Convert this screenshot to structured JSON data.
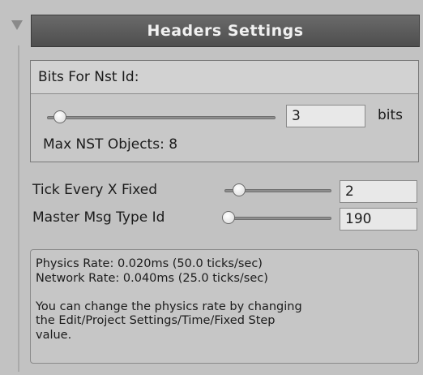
{
  "header": {
    "title": "Headers Settings",
    "fold_icon": "triangle-down-icon"
  },
  "bits_section": {
    "title": "Bits For Nst Id:",
    "value": "3",
    "slider_fraction": 0.1,
    "unit": "bits",
    "max_objects_label": "Max NST Objects: 8"
  },
  "tick_every": {
    "label": "Tick Every X Fixed",
    "value": "2",
    "slider_fraction": 0.1
  },
  "master_msg": {
    "label": "Master Msg Type Id",
    "value": "190",
    "slider_fraction": 0.0
  },
  "info": {
    "text": "Physics Rate: 0.020ms (50.0 ticks/sec)\nNetwork Rate: 0.040ms (25.0 ticks/sec)\n\nYou can change the physics rate by changing\nthe Edit/Project Settings/Time/Fixed Step\nvalue."
  },
  "colors": {
    "panel_bg": "#c2c2c2",
    "header_bg": "#5a5a5a",
    "header_text": "#f0f0f0",
    "field_bg": "#e8e8e8"
  }
}
